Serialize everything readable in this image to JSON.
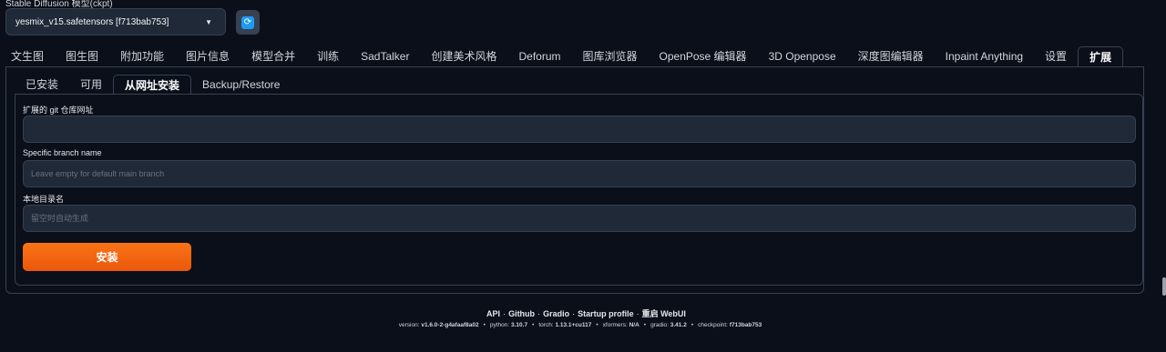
{
  "checkpoint": {
    "label": "Stable Diffusion 模型(ckpt)",
    "value": "yesmix_v15.safetensors [f713bab753]",
    "refresh_icon": "refresh-icon"
  },
  "top_tabs": [
    "文生图",
    "图生图",
    "附加功能",
    "图片信息",
    "模型合并",
    "训练",
    "SadTalker",
    "创建美术风格",
    "Deforum",
    "图库浏览器",
    "OpenPose 编辑器",
    "3D Openpose",
    "深度图编辑器",
    "Inpaint Anything",
    "设置",
    "扩展"
  ],
  "top_tabs_active": 15,
  "sub_tabs": [
    "已安装",
    "可用",
    "从网址安装",
    "Backup/Restore"
  ],
  "sub_tabs_active": 2,
  "form": {
    "git_url_label": "扩展的 git 仓库网址",
    "git_url_value": "",
    "branch_label": "Specific branch name",
    "branch_placeholder": "Leave empty for default main branch",
    "dir_label": "本地目录名",
    "dir_placeholder": "留空时自动生成",
    "install_label": "安装"
  },
  "footer": {
    "links": [
      "API",
      "Github",
      "Gradio",
      "Startup profile",
      "重启 WebUI"
    ],
    "separator": "·",
    "versions": [
      {
        "key": "version:",
        "value": "v1.6.0-2-g4afaaf8a02"
      },
      {
        "key": "python:",
        "value": "3.10.7"
      },
      {
        "key": "torch:",
        "value": "1.13.1+cu117"
      },
      {
        "key": "xformers:",
        "value": "N/A"
      },
      {
        "key": "gradio:",
        "value": "3.41.2"
      },
      {
        "key": "checkpoint:",
        "value": "f713bab753"
      }
    ],
    "version_separator": "•"
  },
  "colors": {
    "background": "#0b0f19",
    "accent": "#f97316",
    "refresh": "#1d9bf0"
  }
}
